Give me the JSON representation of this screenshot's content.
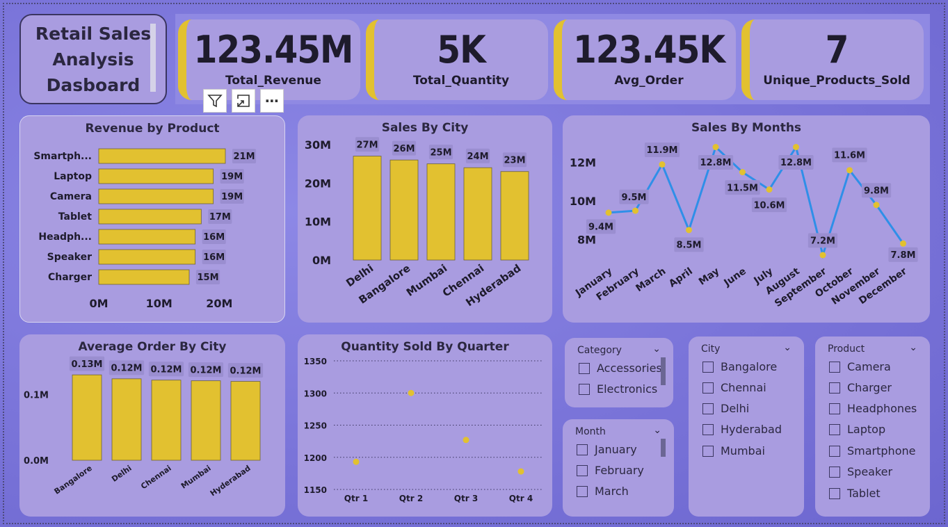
{
  "title": "Retail Sales Analysis Dasboard",
  "kpis": [
    {
      "value": "123.45M",
      "label": "Total_Revenue"
    },
    {
      "value": "5K",
      "label": "Total_Quantity"
    },
    {
      "value": "123.45K",
      "label": "Avg_Order"
    },
    {
      "value": "7",
      "label": "Unique_Products_Sold"
    }
  ],
  "toolbar": {
    "filter_icon": "filter-icon",
    "focus_icon": "focus-mode-icon",
    "more_icon": "more-options-icon",
    "more_label": "⋯"
  },
  "colors": {
    "bar": "#e2c130",
    "line": "#2f8fe8",
    "card": "#a99ce0",
    "accent": "#e2c130"
  },
  "chart_data": [
    {
      "id": "revenue_by_product",
      "type": "bar",
      "orientation": "horizontal",
      "title": "Revenue by Product",
      "categories": [
        "Smartph...",
        "Laptop",
        "Camera",
        "Tablet",
        "Headph...",
        "Speaker",
        "Charger"
      ],
      "values": [
        21,
        19,
        19,
        17,
        16,
        16,
        15
      ],
      "data_labels": [
        "21M",
        "19M",
        "19M",
        "17M",
        "16M",
        "16M",
        "15M"
      ],
      "xticks": [
        "0M",
        "10M",
        "20M"
      ],
      "xlim": [
        0,
        24
      ]
    },
    {
      "id": "sales_by_city",
      "type": "bar",
      "title": "Sales By City",
      "categories": [
        "Delhi",
        "Bangalore",
        "Mumbai",
        "Chennai",
        "Hyderabad"
      ],
      "values": [
        27,
        26,
        25,
        24,
        23
      ],
      "data_labels": [
        "27M",
        "26M",
        "25M",
        "24M",
        "23M"
      ],
      "yticks": [
        "0M",
        "10M",
        "20M",
        "30M"
      ],
      "ylim": [
        0,
        30
      ]
    },
    {
      "id": "sales_by_months",
      "type": "line",
      "title": "Sales By Months",
      "categories": [
        "January",
        "February",
        "March",
        "April",
        "May",
        "June",
        "July",
        "August",
        "September",
        "October",
        "November",
        "December"
      ],
      "values": [
        9.4,
        9.5,
        11.9,
        8.5,
        12.8,
        11.5,
        10.6,
        12.8,
        7.2,
        11.6,
        9.8,
        7.8
      ],
      "data_labels": [
        "9.4M",
        "9.5M",
        "11.9M",
        "8.5M",
        "12.8M",
        "11.5M",
        "10.6M",
        "12.8M",
        "7.2M",
        "11.6M",
        "9.8M",
        "7.8M"
      ],
      "yticks": [
        "8M",
        "10M",
        "12M"
      ],
      "ylim": [
        6.8,
        13.0
      ]
    },
    {
      "id": "average_order_by_city",
      "type": "bar",
      "title": "Average Order By City",
      "categories": [
        "Bangalore",
        "Delhi",
        "Chennai",
        "Mumbai",
        "Hyderabad"
      ],
      "values": [
        0.13,
        0.124,
        0.122,
        0.121,
        0.12
      ],
      "data_labels": [
        "0.13M",
        "0.12M",
        "0.12M",
        "0.12M",
        "0.12M"
      ],
      "yticks": [
        "0.0M",
        "0.1M"
      ],
      "ylim": [
        0,
        0.145
      ]
    },
    {
      "id": "quantity_sold_by_quarter",
      "type": "scatter",
      "title": "Quantity Sold By Quarter",
      "categories": [
        "Qtr 1",
        "Qtr 2",
        "Qtr 3",
        "Qtr 4"
      ],
      "values": [
        1193,
        1300,
        1227,
        1178
      ],
      "yticks": [
        "1150",
        "1200",
        "1250",
        "1300",
        "1350"
      ],
      "ylim": [
        1150,
        1350
      ]
    }
  ],
  "slicers": {
    "category": {
      "title": "Category",
      "items": [
        "Accessories",
        "Electronics"
      ]
    },
    "month": {
      "title": "Month",
      "items": [
        "January",
        "February",
        "March"
      ]
    },
    "city": {
      "title": "City",
      "items": [
        "Bangalore",
        "Chennai",
        "Delhi",
        "Hyderabad",
        "Mumbai"
      ]
    },
    "product": {
      "title": "Product",
      "items": [
        "Camera",
        "Charger",
        "Headphones",
        "Laptop",
        "Smartphone",
        "Speaker",
        "Tablet"
      ]
    }
  }
}
